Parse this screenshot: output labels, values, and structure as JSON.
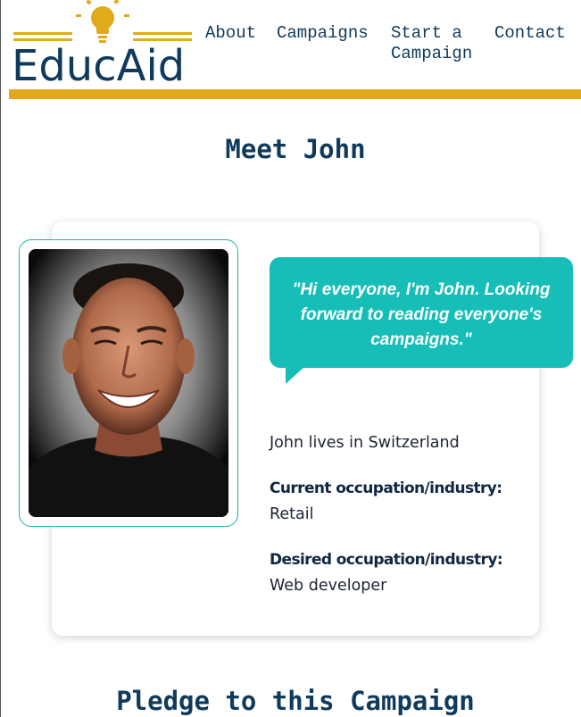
{
  "brand": {
    "name": "EducAid",
    "primary_color": "#0f3a5c",
    "accent_color": "#e0aa1c",
    "teal_color": "#17bdb7",
    "logo_icon": "lightbulb-icon"
  },
  "nav": {
    "items": [
      {
        "label": "About"
      },
      {
        "label": "Campaigns"
      },
      {
        "label": "Start a Campaign"
      },
      {
        "label": "Contact"
      }
    ]
  },
  "profile": {
    "title": "Meet John",
    "photo_alt": "photo of John",
    "quote": "\"Hi everyone, I'm John. Looking forward to reading everyone's campaigns.\"",
    "location_text": "John lives in Switzerland",
    "current_label": "Current occupation/industry:",
    "current_value": "Retail",
    "desired_label": "Desired occupation/industry:",
    "desired_value": "Web developer"
  },
  "pledge": {
    "title": "Pledge to this Campaign"
  }
}
